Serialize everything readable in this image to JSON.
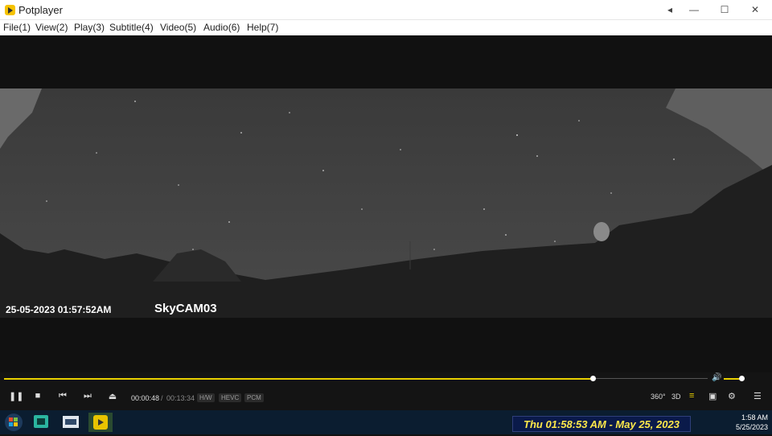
{
  "window": {
    "title": "Potplayer",
    "icons": {
      "app": "potplayer-icon",
      "back": "chevron-left-icon",
      "minimize": "minimize-icon",
      "maximize": "maximize-icon",
      "close": "close-icon"
    },
    "glyphs": {
      "back": "◂",
      "minimize": "—",
      "maximize": "☐",
      "close": "✕"
    }
  },
  "menu": {
    "items": [
      "File(1)",
      "View(2)",
      "Play(3)",
      "Subtitle(4)",
      "Video(5)",
      "Audio(6)",
      "Help(7)"
    ]
  },
  "video": {
    "osd_timestamp": "25-05-2023 01:57:52AM",
    "osd_camera": "SkyCAM03"
  },
  "playback": {
    "current_time": "00:00:48",
    "separator": "/",
    "total_time": "00:13:34",
    "progress": 0.837,
    "volume": 0.83,
    "badges": [
      "H/W",
      "HEVC",
      "PCM"
    ],
    "right_labels": {
      "vr": "360°",
      "stereo": "3D"
    },
    "accent_color": "#e8d000"
  },
  "taskbar": {
    "banner": "Thu 01:58:53 AM - May 25, 2023",
    "time": "1:58 AM",
    "date": "5/25/2023",
    "banner_bg": "#0a1a4a",
    "banner_fg": "#ffe94a"
  }
}
